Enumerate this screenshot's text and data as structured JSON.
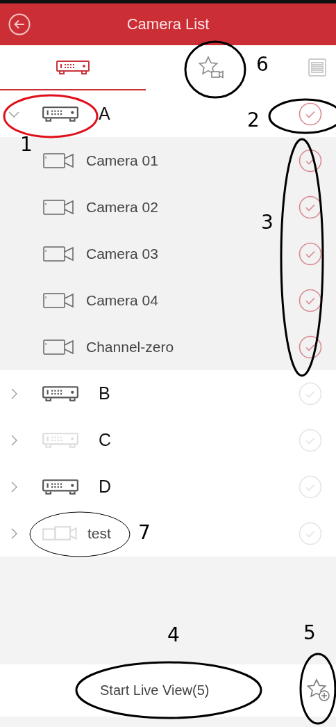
{
  "header": {
    "title": "Camera List"
  },
  "tabs": [
    {
      "kind": "device",
      "selected": true
    },
    {
      "kind": "favorite",
      "selected": false
    },
    {
      "kind": "list",
      "selected": false
    }
  ],
  "devices": [
    {
      "name": "A",
      "kind": "dvr",
      "online": true,
      "expanded": true,
      "checked": true,
      "children": [
        {
          "name": "Camera 01",
          "checked": true
        },
        {
          "name": "Camera 02",
          "checked": true
        },
        {
          "name": "Camera 03",
          "checked": true
        },
        {
          "name": "Camera 04",
          "checked": true
        },
        {
          "name": "Channel-zero",
          "checked": true
        }
      ]
    },
    {
      "name": "B",
      "kind": "dvr",
      "online": true,
      "expanded": false,
      "checked": false
    },
    {
      "name": "C",
      "kind": "dvr",
      "online": false,
      "expanded": false,
      "checked": false
    },
    {
      "name": "D",
      "kind": "dvr",
      "online": true,
      "expanded": false,
      "checked": false
    },
    {
      "name": "test",
      "kind": "camera",
      "online": false,
      "expanded": false,
      "checked": false
    }
  ],
  "footer": {
    "button": "Start Live View(5)"
  },
  "annotations": [
    {
      "label": "1"
    },
    {
      "label": "2"
    },
    {
      "label": "3"
    },
    {
      "label": "4"
    },
    {
      "label": "5"
    },
    {
      "label": "6"
    },
    {
      "label": "7"
    }
  ]
}
